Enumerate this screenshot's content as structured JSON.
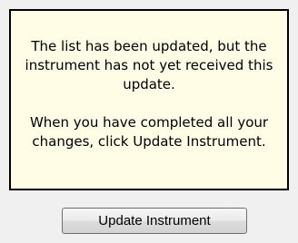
{
  "notice": {
    "paragraph_1": "The list has been updated, but the instrument has not yet received this update.",
    "paragraph_2": "When you have completed all your changes, click Update Instrument."
  },
  "actions": {
    "update_button_label": "Update Instrument"
  },
  "colors": {
    "notice_background": "#fffde6",
    "notice_border": "#000000",
    "window_background": "#f0f0f0"
  }
}
